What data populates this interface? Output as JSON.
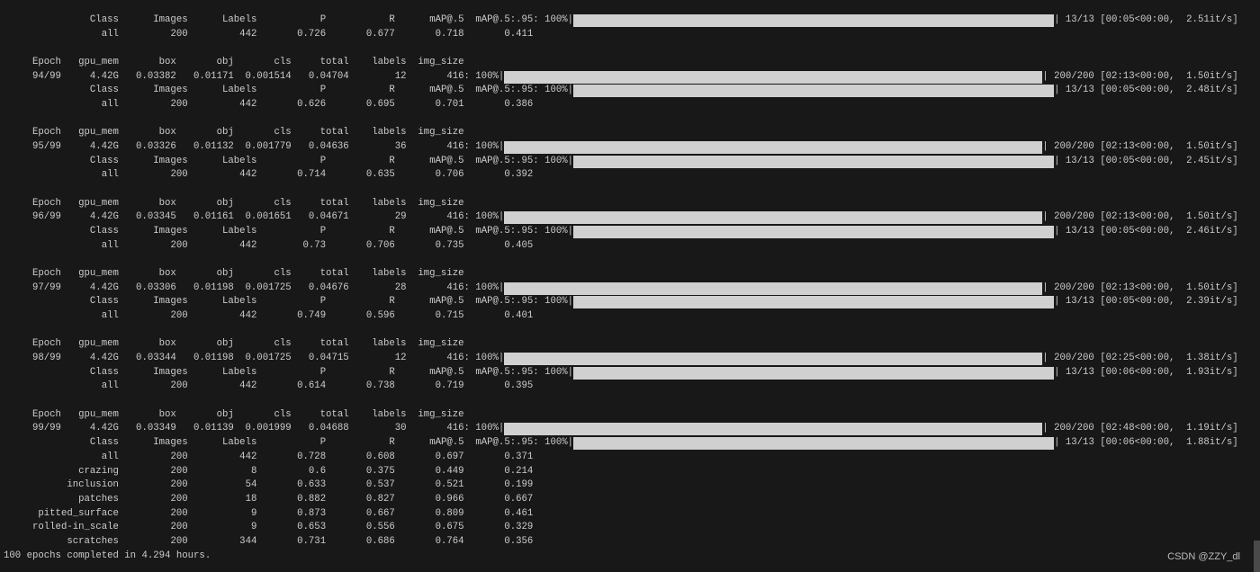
{
  "terminal": {
    "train_columns": [
      "Epoch",
      "gpu_mem",
      "box",
      "obj",
      "cls",
      "total",
      "labels",
      "img_size"
    ],
    "train_suffix": ": 100%|",
    "val_columns": [
      "Class",
      "Images",
      "Labels",
      "P",
      "R",
      "mAP@.5",
      "mAP@.5:.95"
    ],
    "val_suffix": ": 100%|",
    "first_val": {
      "progress": "13/13 [00:05<00:00,  2.51it/s]",
      "rows": [
        [
          "all",
          "200",
          "442",
          "0.726",
          "0.677",
          "0.718",
          "0.411"
        ]
      ]
    },
    "epochs": [
      {
        "train": [
          "94/99",
          "4.42G",
          "0.03382",
          "0.01171",
          "0.001514",
          "0.04704",
          "12",
          "416"
        ],
        "train_progress": "200/200 [02:13<00:00,  1.50it/s]",
        "val_progress": "13/13 [00:05<00:00,  2.48it/s]",
        "val_rows": [
          [
            "all",
            "200",
            "442",
            "0.626",
            "0.695",
            "0.701",
            "0.386"
          ]
        ]
      },
      {
        "train": [
          "95/99",
          "4.42G",
          "0.03326",
          "0.01132",
          "0.001779",
          "0.04636",
          "36",
          "416"
        ],
        "train_progress": "200/200 [02:13<00:00,  1.50it/s]",
        "val_progress": "13/13 [00:05<00:00,  2.45it/s]",
        "val_rows": [
          [
            "all",
            "200",
            "442",
            "0.714",
            "0.635",
            "0.706",
            "0.392"
          ]
        ]
      },
      {
        "train": [
          "96/99",
          "4.42G",
          "0.03345",
          "0.01161",
          "0.001651",
          "0.04671",
          "29",
          "416"
        ],
        "train_progress": "200/200 [02:13<00:00,  1.50it/s]",
        "val_progress": "13/13 [00:05<00:00,  2.46it/s]",
        "val_rows": [
          [
            "all",
            "200",
            "442",
            "0.73",
            "0.706",
            "0.735",
            "0.405"
          ]
        ]
      },
      {
        "train": [
          "97/99",
          "4.42G",
          "0.03306",
          "0.01198",
          "0.001725",
          "0.04676",
          "28",
          "416"
        ],
        "train_progress": "200/200 [02:13<00:00,  1.50it/s]",
        "val_progress": "13/13 [00:05<00:00,  2.39it/s]",
        "val_rows": [
          [
            "all",
            "200",
            "442",
            "0.749",
            "0.596",
            "0.715",
            "0.401"
          ]
        ]
      },
      {
        "train": [
          "98/99",
          "4.42G",
          "0.03344",
          "0.01198",
          "0.001725",
          "0.04715",
          "12",
          "416"
        ],
        "train_progress": "200/200 [02:25<00:00,  1.38it/s]",
        "val_progress": "13/13 [00:06<00:00,  1.93it/s]",
        "val_rows": [
          [
            "all",
            "200",
            "442",
            "0.614",
            "0.738",
            "0.719",
            "0.395"
          ]
        ]
      },
      {
        "train": [
          "99/99",
          "4.42G",
          "0.03349",
          "0.01139",
          "0.001999",
          "0.04688",
          "30",
          "416"
        ],
        "train_progress": "200/200 [02:48<00:00,  1.19it/s]",
        "val_progress": "13/13 [00:06<00:00,  1.88it/s]",
        "val_rows": [
          [
            "all",
            "200",
            "442",
            "0.728",
            "0.608",
            "0.697",
            "0.371"
          ],
          [
            "crazing",
            "200",
            "8",
            "0.6",
            "0.375",
            "0.449",
            "0.214"
          ],
          [
            "inclusion",
            "200",
            "54",
            "0.633",
            "0.537",
            "0.521",
            "0.199"
          ],
          [
            "patches",
            "200",
            "18",
            "0.882",
            "0.827",
            "0.966",
            "0.667"
          ],
          [
            "pitted_surface",
            "200",
            "9",
            "0.873",
            "0.667",
            "0.809",
            "0.461"
          ],
          [
            "rolled-in_scale",
            "200",
            "9",
            "0.653",
            "0.556",
            "0.675",
            "0.329"
          ],
          [
            "scratches",
            "200",
            "344",
            "0.731",
            "0.686",
            "0.764",
            "0.356"
          ]
        ]
      }
    ],
    "summary": "100 epochs completed in 4.294 hours."
  },
  "progress_bars": {
    "percent": 100,
    "color": "#d0d0d0"
  },
  "watermark": "CSDN @ZZY_dl"
}
